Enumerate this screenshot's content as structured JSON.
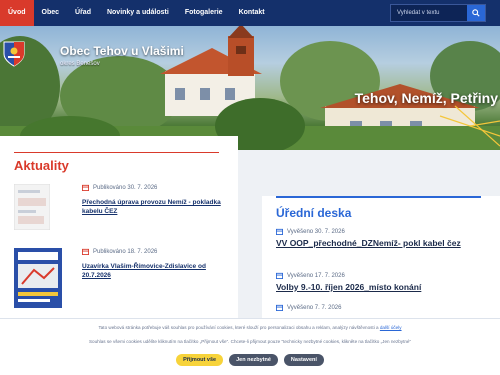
{
  "nav": {
    "items": [
      {
        "label": "Úvod",
        "active": true
      },
      {
        "label": "Obec"
      },
      {
        "label": "Úřad"
      },
      {
        "label": "Novinky a události"
      },
      {
        "label": "Fotogalerie"
      },
      {
        "label": "Kontakt"
      }
    ],
    "search_placeholder": "Vyhledat v textu"
  },
  "hero": {
    "title": "Obec Tehov u Vlašimi",
    "subtitle": "okres Benešov",
    "caption": "Tehov, Nemíž, Petřiny"
  },
  "news": {
    "title": "Aktuality",
    "items": [
      {
        "date": "Publikováno 30. 7. 2026",
        "title": "Přechodná úprava provozu Nemíž - pokladka kabelu ČEZ"
      },
      {
        "date": "Publikováno 18. 7. 2026",
        "title": "Uzavírka Vlašim-Římovice-Zdislavice od 20.7.2026"
      }
    ]
  },
  "board": {
    "title": "Úřední deska",
    "items": [
      {
        "date": "Vyvěšeno 30. 7. 2026",
        "title": "VV OOP_přechodné_DZNemíž- pokl kabel čez"
      },
      {
        "date": "Vyvěšeno 17. 7. 2026",
        "title": "Volby 9.-10. říjen 2026_místo konání"
      },
      {
        "date": "Vyvěšeno 7. 7. 2026",
        "title": ""
      }
    ]
  },
  "cookie": {
    "text1": "Tato webová stránka potřebuje váš souhlas pro používání cookies, které slouží pro personalizaci obsahu a reklam, analýzy návštěvnosti a",
    "link": "další účely",
    "text2": "Souhlas se všemi cookies udělíte kliknutím na tlačítko „Přijmout vše“. Chcete-li přijmout pouze \"technicky nezbytné cookies, klikněte na tlačítko „Jen nezbytné“",
    "accept": "Přijmout vše",
    "necessary": "Jen nezbytné",
    "settings": "Nastavení"
  },
  "colors": {
    "nav": "#14306b",
    "accent_red": "#d93a2b",
    "accent_blue": "#2a67d6"
  }
}
